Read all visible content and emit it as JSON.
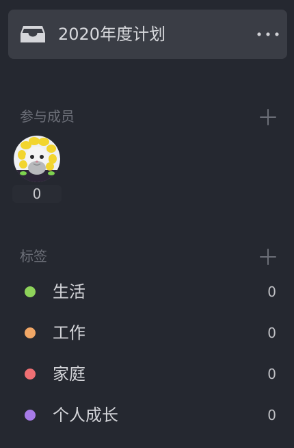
{
  "project": {
    "title": "2020年度计划",
    "icon": "inbox-tray-icon",
    "menu_icon": "more-horizontal-icon"
  },
  "members": {
    "section_title": "参与成员",
    "add_icon": "plus-icon",
    "avatar": {
      "image": "cat-with-flower-costume",
      "count": "0"
    }
  },
  "tags": {
    "section_title": "标签",
    "add_icon": "plus-icon",
    "items": [
      {
        "label": "生活",
        "count": "0",
        "color": "#8ed35a"
      },
      {
        "label": "工作",
        "count": "0",
        "color": "#f1a766"
      },
      {
        "label": "家庭",
        "count": "0",
        "color": "#ef6f73"
      },
      {
        "label": "个人成长",
        "count": "0",
        "color": "#a77be8"
      }
    ]
  },
  "colors": {
    "background": "#252830",
    "header_background": "#3a3d45",
    "muted_text": "#6c6f78",
    "primary_text": "#d7d8dc"
  }
}
